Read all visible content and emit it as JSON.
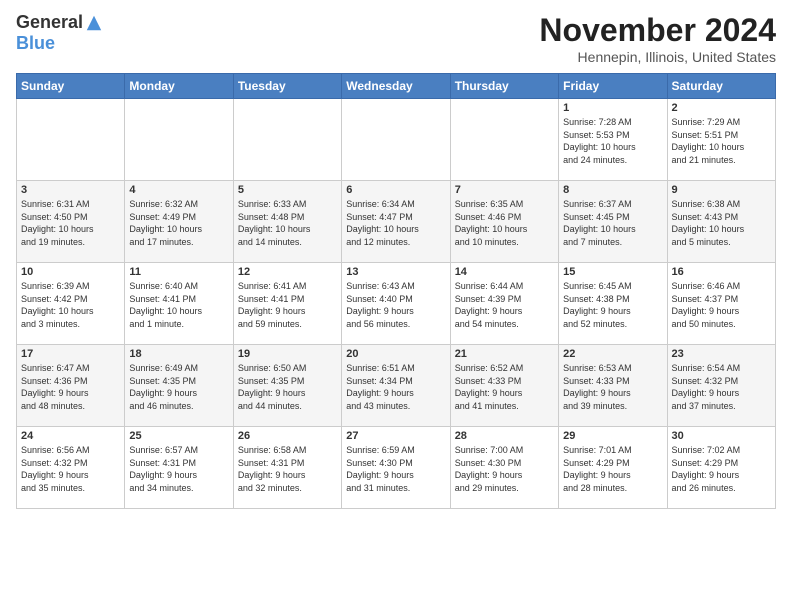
{
  "logo": {
    "general": "General",
    "blue": "Blue"
  },
  "header": {
    "month": "November 2024",
    "location": "Hennepin, Illinois, United States"
  },
  "weekdays": [
    "Sunday",
    "Monday",
    "Tuesday",
    "Wednesday",
    "Thursday",
    "Friday",
    "Saturday"
  ],
  "weeks": [
    [
      {
        "day": "",
        "info": ""
      },
      {
        "day": "",
        "info": ""
      },
      {
        "day": "",
        "info": ""
      },
      {
        "day": "",
        "info": ""
      },
      {
        "day": "",
        "info": ""
      },
      {
        "day": "1",
        "info": "Sunrise: 7:28 AM\nSunset: 5:53 PM\nDaylight: 10 hours\nand 24 minutes."
      },
      {
        "day": "2",
        "info": "Sunrise: 7:29 AM\nSunset: 5:51 PM\nDaylight: 10 hours\nand 21 minutes."
      }
    ],
    [
      {
        "day": "3",
        "info": "Sunrise: 6:31 AM\nSunset: 4:50 PM\nDaylight: 10 hours\nand 19 minutes."
      },
      {
        "day": "4",
        "info": "Sunrise: 6:32 AM\nSunset: 4:49 PM\nDaylight: 10 hours\nand 17 minutes."
      },
      {
        "day": "5",
        "info": "Sunrise: 6:33 AM\nSunset: 4:48 PM\nDaylight: 10 hours\nand 14 minutes."
      },
      {
        "day": "6",
        "info": "Sunrise: 6:34 AM\nSunset: 4:47 PM\nDaylight: 10 hours\nand 12 minutes."
      },
      {
        "day": "7",
        "info": "Sunrise: 6:35 AM\nSunset: 4:46 PM\nDaylight: 10 hours\nand 10 minutes."
      },
      {
        "day": "8",
        "info": "Sunrise: 6:37 AM\nSunset: 4:45 PM\nDaylight: 10 hours\nand 7 minutes."
      },
      {
        "day": "9",
        "info": "Sunrise: 6:38 AM\nSunset: 4:43 PM\nDaylight: 10 hours\nand 5 minutes."
      }
    ],
    [
      {
        "day": "10",
        "info": "Sunrise: 6:39 AM\nSunset: 4:42 PM\nDaylight: 10 hours\nand 3 minutes."
      },
      {
        "day": "11",
        "info": "Sunrise: 6:40 AM\nSunset: 4:41 PM\nDaylight: 10 hours\nand 1 minute."
      },
      {
        "day": "12",
        "info": "Sunrise: 6:41 AM\nSunset: 4:41 PM\nDaylight: 9 hours\nand 59 minutes."
      },
      {
        "day": "13",
        "info": "Sunrise: 6:43 AM\nSunset: 4:40 PM\nDaylight: 9 hours\nand 56 minutes."
      },
      {
        "day": "14",
        "info": "Sunrise: 6:44 AM\nSunset: 4:39 PM\nDaylight: 9 hours\nand 54 minutes."
      },
      {
        "day": "15",
        "info": "Sunrise: 6:45 AM\nSunset: 4:38 PM\nDaylight: 9 hours\nand 52 minutes."
      },
      {
        "day": "16",
        "info": "Sunrise: 6:46 AM\nSunset: 4:37 PM\nDaylight: 9 hours\nand 50 minutes."
      }
    ],
    [
      {
        "day": "17",
        "info": "Sunrise: 6:47 AM\nSunset: 4:36 PM\nDaylight: 9 hours\nand 48 minutes."
      },
      {
        "day": "18",
        "info": "Sunrise: 6:49 AM\nSunset: 4:35 PM\nDaylight: 9 hours\nand 46 minutes."
      },
      {
        "day": "19",
        "info": "Sunrise: 6:50 AM\nSunset: 4:35 PM\nDaylight: 9 hours\nand 44 minutes."
      },
      {
        "day": "20",
        "info": "Sunrise: 6:51 AM\nSunset: 4:34 PM\nDaylight: 9 hours\nand 43 minutes."
      },
      {
        "day": "21",
        "info": "Sunrise: 6:52 AM\nSunset: 4:33 PM\nDaylight: 9 hours\nand 41 minutes."
      },
      {
        "day": "22",
        "info": "Sunrise: 6:53 AM\nSunset: 4:33 PM\nDaylight: 9 hours\nand 39 minutes."
      },
      {
        "day": "23",
        "info": "Sunrise: 6:54 AM\nSunset: 4:32 PM\nDaylight: 9 hours\nand 37 minutes."
      }
    ],
    [
      {
        "day": "24",
        "info": "Sunrise: 6:56 AM\nSunset: 4:32 PM\nDaylight: 9 hours\nand 35 minutes."
      },
      {
        "day": "25",
        "info": "Sunrise: 6:57 AM\nSunset: 4:31 PM\nDaylight: 9 hours\nand 34 minutes."
      },
      {
        "day": "26",
        "info": "Sunrise: 6:58 AM\nSunset: 4:31 PM\nDaylight: 9 hours\nand 32 minutes."
      },
      {
        "day": "27",
        "info": "Sunrise: 6:59 AM\nSunset: 4:30 PM\nDaylight: 9 hours\nand 31 minutes."
      },
      {
        "day": "28",
        "info": "Sunrise: 7:00 AM\nSunset: 4:30 PM\nDaylight: 9 hours\nand 29 minutes."
      },
      {
        "day": "29",
        "info": "Sunrise: 7:01 AM\nSunset: 4:29 PM\nDaylight: 9 hours\nand 28 minutes."
      },
      {
        "day": "30",
        "info": "Sunrise: 7:02 AM\nSunset: 4:29 PM\nDaylight: 9 hours\nand 26 minutes."
      }
    ]
  ]
}
